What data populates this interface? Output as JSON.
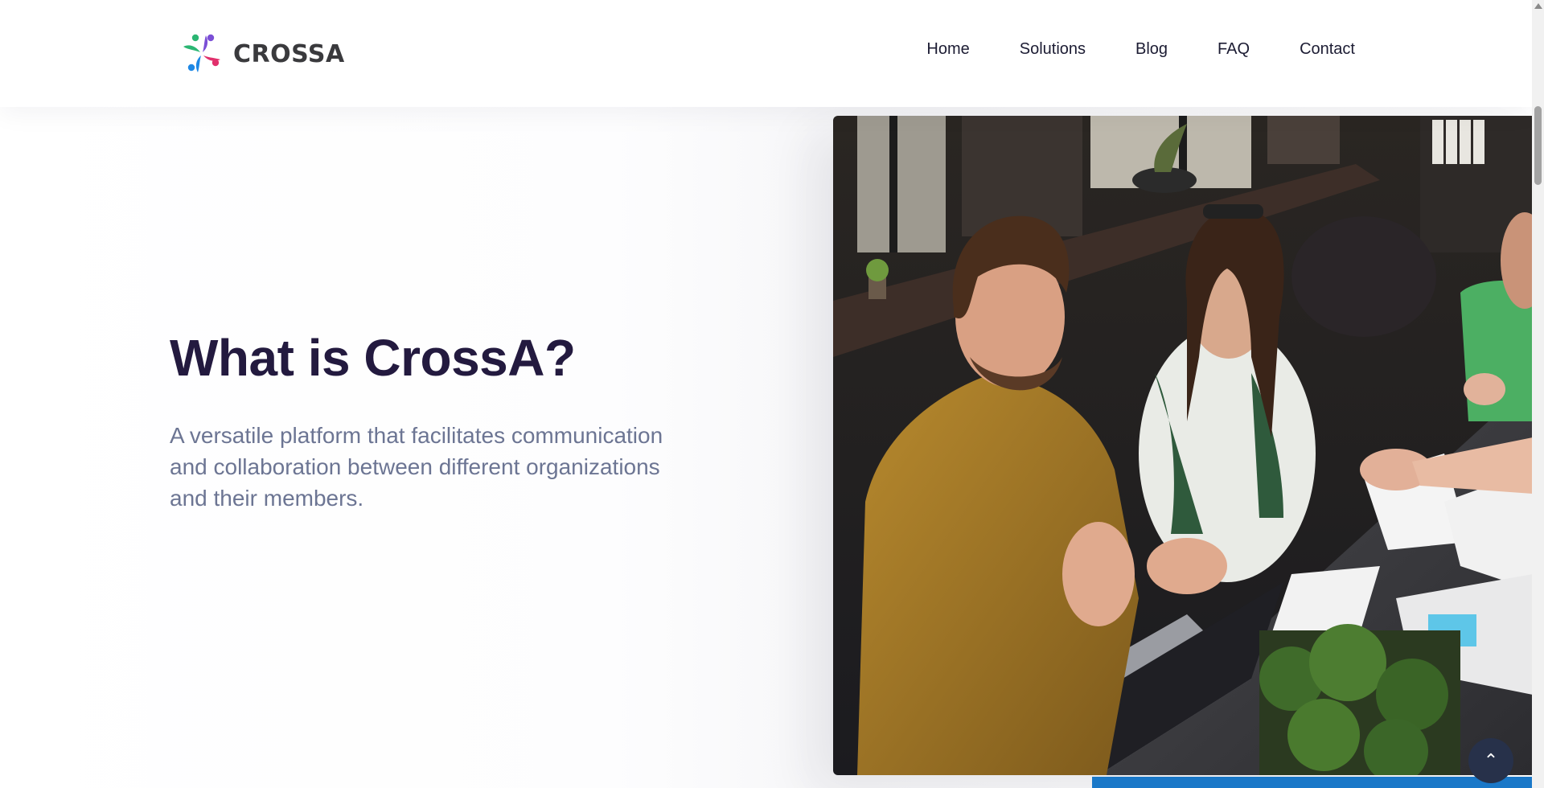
{
  "brand": {
    "name": "CROSSA",
    "colors": [
      "#2bb673",
      "#7b4fd6",
      "#e1306c",
      "#1e88e5"
    ]
  },
  "nav": {
    "items": [
      {
        "label": "Home"
      },
      {
        "label": "Solutions"
      },
      {
        "label": "Blog"
      },
      {
        "label": "FAQ"
      },
      {
        "label": "Contact"
      }
    ]
  },
  "hero": {
    "title": "What is CrossA?",
    "description": "A versatile platform that facilitates communication and collaboration between different organizations and their members.",
    "image_alt": "Team meeting around a table with a handshake",
    "accent_color": "#1a78c8"
  },
  "scroll_top": {
    "icon": "chevron-up-icon",
    "glyph": "⌃"
  }
}
